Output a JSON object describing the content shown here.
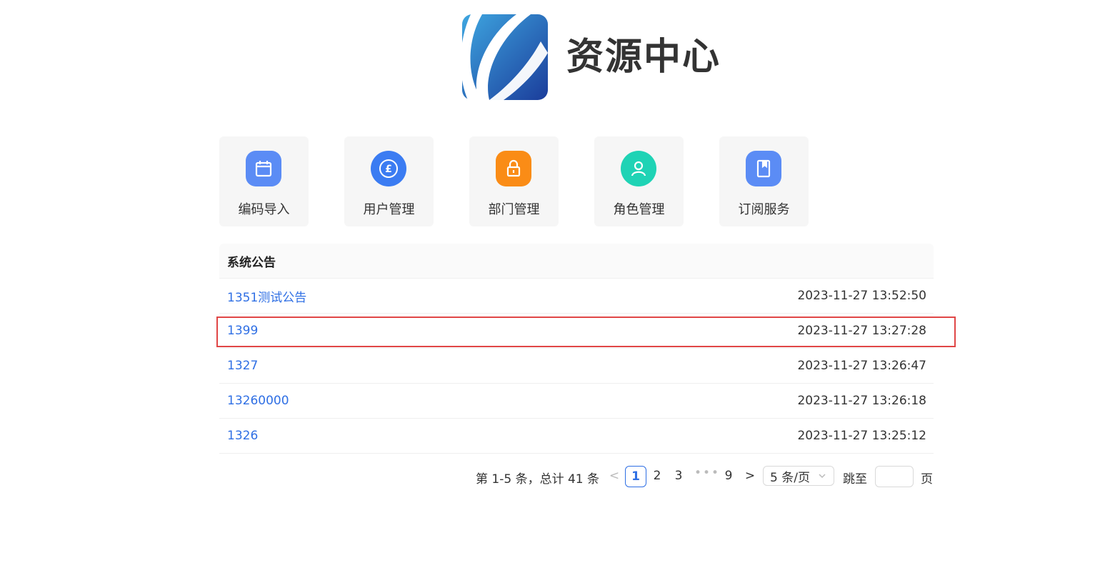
{
  "header": {
    "app_title": "资源中心",
    "logo_icon": "brand-swoosh-logo"
  },
  "tiles": [
    {
      "label": "编码导入",
      "icon": "calendar-icon",
      "color": "#5b8cf5"
    },
    {
      "label": "用户管理",
      "icon": "pound-coin-icon",
      "color": "#3b7cf2"
    },
    {
      "label": "部门管理",
      "icon": "lock-icon",
      "color": "#fa8c16"
    },
    {
      "label": "角色管理",
      "icon": "user-icon",
      "color": "#1fd3b5"
    },
    {
      "label": "订阅服务",
      "icon": "bookmark-book-icon",
      "color": "#5b8cf5"
    }
  ],
  "notice": {
    "title": "系统公告",
    "rows": [
      {
        "title": "1351测试公告",
        "time": "2023-11-27 13:52:50"
      },
      {
        "title": "1399",
        "time": "2023-11-27 13:27:28"
      },
      {
        "title": "1327",
        "time": "2023-11-27 13:26:47"
      },
      {
        "title": "13260000",
        "time": "2023-11-27 13:26:18"
      },
      {
        "title": "1326",
        "time": "2023-11-27 13:25:12"
      }
    ]
  },
  "pagination": {
    "total_text": "第 1-5 条，总计 41 条",
    "prev": "<",
    "next": ">",
    "pages": [
      "1",
      "2",
      "3",
      "9"
    ],
    "ellipsis": "•••",
    "current": "1",
    "page_size": "5 条/页",
    "jump_label": "跳至",
    "jump_value": "",
    "page_suffix": "页"
  },
  "colors": {
    "link": "#2f6fe4",
    "highlight": "#e04646"
  }
}
